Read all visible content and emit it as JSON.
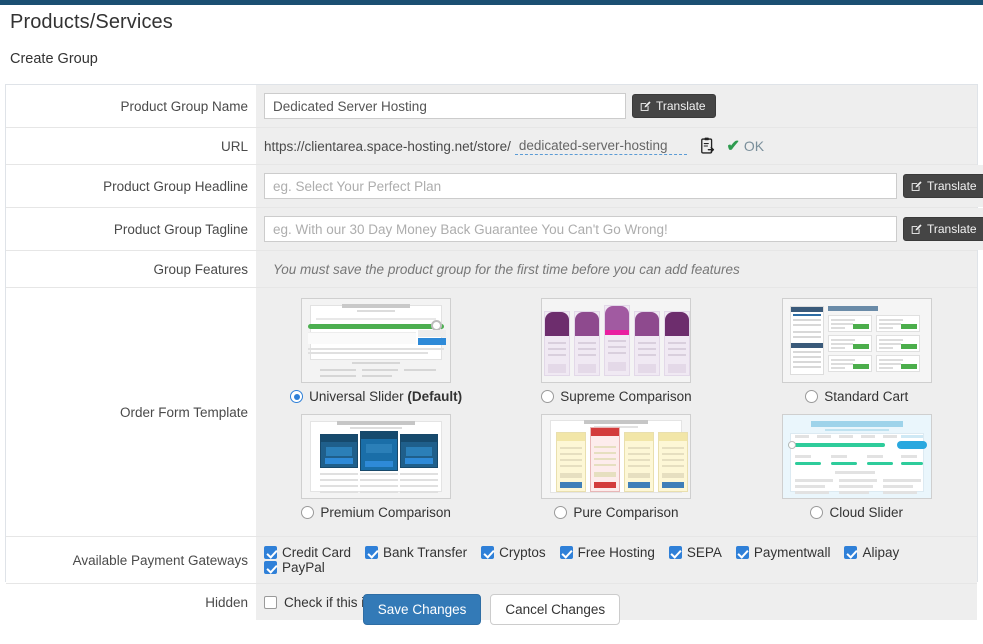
{
  "page": {
    "title": "Products/Services",
    "subtitle": "Create Group"
  },
  "form": {
    "rows": {
      "product_group_name": {
        "label": "Product Group Name",
        "value": "Dedicated Server Hosting",
        "translate_label": "Translate"
      },
      "url": {
        "label": "URL",
        "base": "https://clientarea.space-hosting.net/store/",
        "slug": "dedicated-server-hosting",
        "copy_icon": "clipboard-icon",
        "status_icon": "check-icon",
        "status_text": "OK"
      },
      "product_group_headline": {
        "label": "Product Group Headline",
        "value": "",
        "placeholder": "eg. Select Your Perfect Plan",
        "translate_label": "Translate"
      },
      "product_group_tagline": {
        "label": "Product Group Tagline",
        "value": "",
        "placeholder": "eg. With our 30 Day Money Back Guarantee You Can't Go Wrong!",
        "translate_label": "Translate"
      },
      "group_features": {
        "label": "Group Features",
        "note": "You must save the product group for the first time before you can add features"
      },
      "order_form_template": {
        "label": "Order Form Template"
      },
      "available_payment_gateways": {
        "label": "Available Payment Gateways"
      },
      "hidden": {
        "label": "Hidden",
        "checkbox_label": "Check if this is a hidden group",
        "checked": false
      }
    }
  },
  "order_form_templates": [
    {
      "name": "Universal Slider",
      "suffix": " (Default)",
      "selected": true
    },
    {
      "name": "Supreme Comparison",
      "suffix": "",
      "selected": false
    },
    {
      "name": "Standard Cart",
      "suffix": "",
      "selected": false
    },
    {
      "name": "Premium Comparison",
      "suffix": "",
      "selected": false
    },
    {
      "name": "Pure Comparison",
      "suffix": "",
      "selected": false
    },
    {
      "name": "Cloud Slider",
      "suffix": "",
      "selected": false
    }
  ],
  "payment_gateways": [
    {
      "label": "Credit Card",
      "checked": true
    },
    {
      "label": "Bank Transfer",
      "checked": true
    },
    {
      "label": "Cryptos",
      "checked": true
    },
    {
      "label": "Free Hosting",
      "checked": true
    },
    {
      "label": "SEPA",
      "checked": true
    },
    {
      "label": "Paymentwall",
      "checked": true
    },
    {
      "label": "Alipay",
      "checked": true
    },
    {
      "label": "PayPal",
      "checked": true
    }
  ],
  "footer": {
    "save_label": "Save Changes",
    "cancel_label": "Cancel Changes"
  },
  "colors": {
    "topbar": "#1b4f72",
    "accent": "#337ab7",
    "checkbox": "#2f80d8",
    "ok_green": "#2e9b4f",
    "field_bg": "#eeeeee",
    "translate_btn": "#454545"
  }
}
